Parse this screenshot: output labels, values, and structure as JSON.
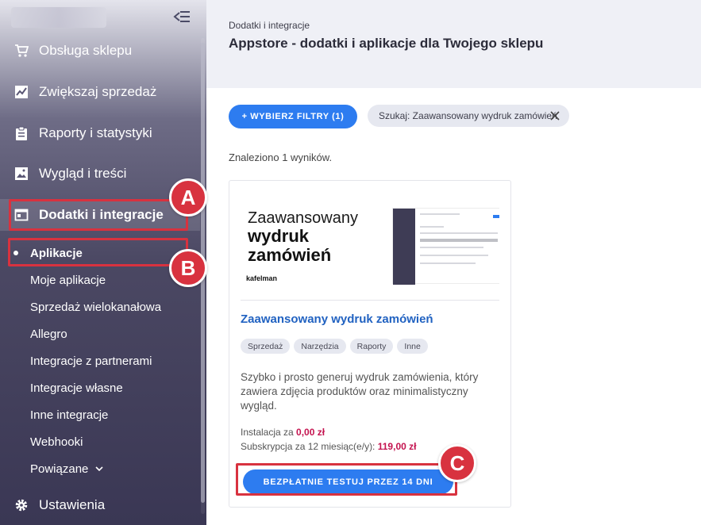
{
  "sidebar": {
    "items": [
      {
        "label": "Obsługa sklepu",
        "icon": "cart-icon"
      },
      {
        "label": "Zwiększaj sprzedaż",
        "icon": "trending-chart-icon"
      },
      {
        "label": "Raporty i statystyki",
        "icon": "clipboard-icon"
      },
      {
        "label": "Wygląd i treści",
        "icon": "image-icon"
      },
      {
        "label": "Dodatki i integracje",
        "icon": "window-icon",
        "active": true
      },
      {
        "label": "Ustawienia",
        "icon": "gear-icon"
      }
    ],
    "subitems": [
      {
        "label": "Aplikacje",
        "current": true
      },
      {
        "label": "Moje aplikacje"
      },
      {
        "label": "Sprzedaż wielokanałowa"
      },
      {
        "label": "Allegro"
      },
      {
        "label": "Integracje z partnerami"
      },
      {
        "label": "Integracje własne"
      },
      {
        "label": "Inne integracje"
      },
      {
        "label": "Webhooki"
      },
      {
        "label": "Powiązane"
      }
    ]
  },
  "callouts": {
    "a": "A",
    "b": "B",
    "c": "C",
    "color": "#d8323f"
  },
  "header": {
    "breadcrumb": "Dodatki i integracje",
    "title": "Appstore - dodatki i aplikacje dla Twojego sklepu"
  },
  "filters": {
    "button_label": "+ WYBIERZ FILTRY (1)",
    "search_chip": "Szukaj: Zaawansowany wydruk zamówień"
  },
  "results_text": "Znaleziono 1 wyników.",
  "app_card": {
    "thumbnail": {
      "line1": "Zaawansowany",
      "line2a": "wydruk",
      "line2b": "zamówień",
      "brand": "kafelman"
    },
    "title": "Zaawansowany wydruk zamówień",
    "tags": [
      "Sprzedaż",
      "Narzędzia",
      "Raporty",
      "Inne"
    ],
    "description": "Szybko i prosto generuj wydruk zamówienia, który zawiera zdjęcia produktów oraz minimalistyczny wygląd.",
    "install_label": "Instalacja za",
    "install_price": "0,00 zł",
    "subscription_label": "Subskrypcja za 12 miesiąc(e/y):",
    "subscription_price": "119,00 zł",
    "try_button": "BEZPŁATNIE TESTUJ PRZEZ 14 DNI"
  },
  "colors": {
    "accent": "#2d7cf0",
    "price": "#c4134f",
    "link": "#2162c1",
    "sidebar": "#4b4863"
  }
}
